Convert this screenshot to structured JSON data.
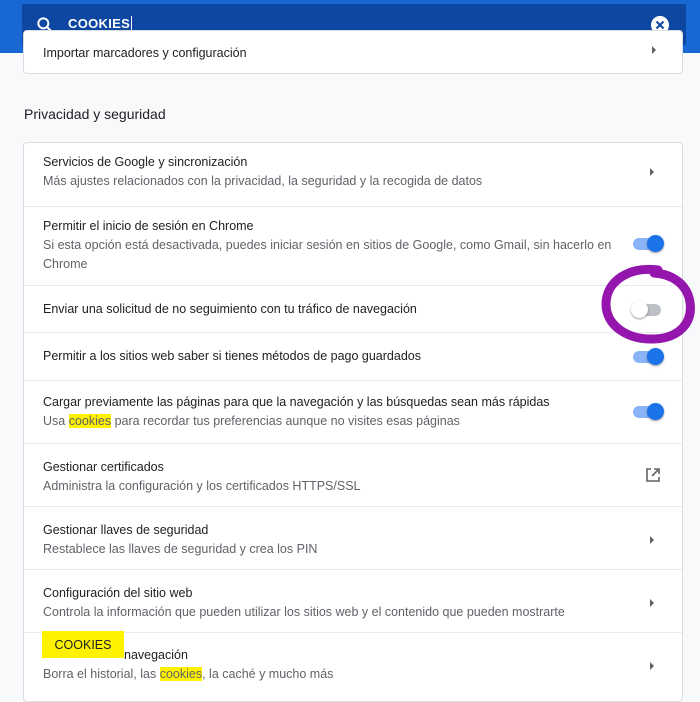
{
  "search": {
    "query": "COOKIES",
    "icon": "search-icon",
    "clear_icon": "close-icon"
  },
  "top_card": {
    "title": "Importar marcadores y configuración"
  },
  "section": {
    "title": "Privacidad y seguridad"
  },
  "rows": [
    {
      "title": "Servicios de Google y sincronización",
      "subtitle": "Más ajustes relacionados con la privacidad, la seguridad y la recogida de datos",
      "control": "chevron"
    },
    {
      "title": "Permitir el inicio de sesión en Chrome",
      "subtitle_line1": "Si esta opción está desactivada, puedes iniciar sesión en sitios de Google, como Gmail, sin hacerlo en",
      "subtitle_line2": "Chrome",
      "control": "toggle",
      "enabled": true
    },
    {
      "title": "Enviar una solicitud de no seguimiento con tu tráfico de navegación",
      "control": "toggle",
      "enabled": false
    },
    {
      "title": "Permitir a los sitios web saber si tienes métodos de pago guardados",
      "control": "toggle",
      "enabled": true
    },
    {
      "title": "Cargar previamente las páginas para que la navegación y las búsquedas sean más rápidas",
      "subtitle_before": "Usa ",
      "subtitle_highlight": "cookies",
      "subtitle_after": " para recordar tus preferencias aunque no visites esas páginas",
      "control": "toggle",
      "enabled": true
    },
    {
      "title": "Gestionar certificados",
      "subtitle": "Administra la configuración y los certificados HTTPS/SSL",
      "control": "external-link"
    },
    {
      "title": "Gestionar llaves de seguridad",
      "subtitle": "Restablece las llaves de seguridad y crea los PIN",
      "control": "chevron"
    },
    {
      "title": "Configuración del sitio web",
      "subtitle": "Controla la información que pueden utilizar los sitios web y el contenido que pueden mostrarte",
      "control": "chevron"
    },
    {
      "title": "navegación",
      "subtitle_before": "Borra el historial, las ",
      "subtitle_highlight": "cookies",
      "subtitle_after": ", la caché y mucho más",
      "control": "chevron"
    }
  ],
  "tooltip": {
    "label": "COOKIES"
  },
  "colors": {
    "header_bg": "#1967d2",
    "search_bg": "#0d47a1",
    "toggle_on": "#1a73e8",
    "highlight": "#fff200",
    "annotation": "#8e0aa8"
  }
}
